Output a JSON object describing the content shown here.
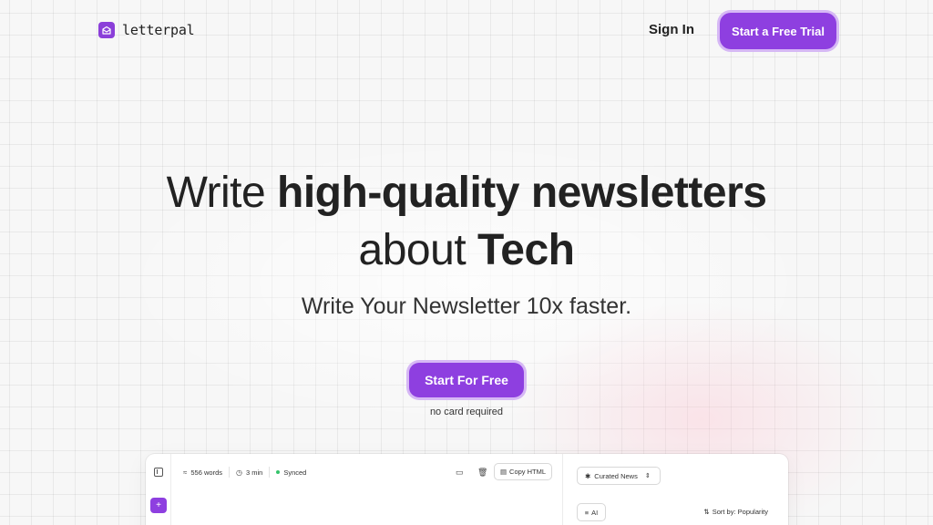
{
  "brand": {
    "name": "letterpal",
    "accent": "#8e3fe0"
  },
  "nav": {
    "signin_label": "Sign In",
    "trial_label": "Start a Free Trial"
  },
  "hero": {
    "line1_light": "Write ",
    "line1_bold": "high-quality newsletters",
    "line2_light": "about ",
    "line2_bold": "Tech",
    "subheadline": "Write Your Newsletter 10x faster.",
    "cta_label": "Start For Free",
    "cta_note": "no card required"
  },
  "preview": {
    "editor": {
      "word_count": "556 words",
      "read_time": "3 min",
      "sync_status": "Synced",
      "copy_label": "Copy HTML"
    },
    "rail": {
      "add_label": "+"
    },
    "side": {
      "source_select": "Curated News",
      "ai_label": "AI",
      "sort_label": "Sort by: Popularity"
    }
  }
}
